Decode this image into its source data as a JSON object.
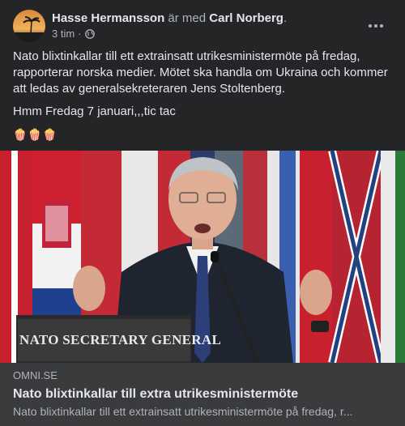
{
  "post": {
    "author_name": "Hasse Hermansson",
    "with_text": "är med",
    "tagged_name": "Carl Norberg",
    "trailing_dot": ".",
    "timestamp": "3 tim",
    "separator": "·",
    "privacy_icon": "globe-icon",
    "more_icon": "more-options-icon",
    "body": {
      "paragraph_1": "Nato blixtinkallar till ett extrainsatt utrikesministermöte på fredag, rapporterar norska medier. Mötet ska handla om Ukraina och kommer att ledas av generalsekreteraren Jens Stoltenberg.",
      "paragraph_2": "Hmm Fredag 7 januari,,,tic tac",
      "emojis": "🍿🍿🍿"
    },
    "image": {
      "sign_text": "NATO SECRETARY GENERAL"
    },
    "link": {
      "domain": "OMNI.SE",
      "title": "Nato blixtinkallar till extra utrikesministermöte",
      "description": "Nato blixtinkallar till ett extrainsatt utrikesministermöte på fredag, r..."
    }
  }
}
